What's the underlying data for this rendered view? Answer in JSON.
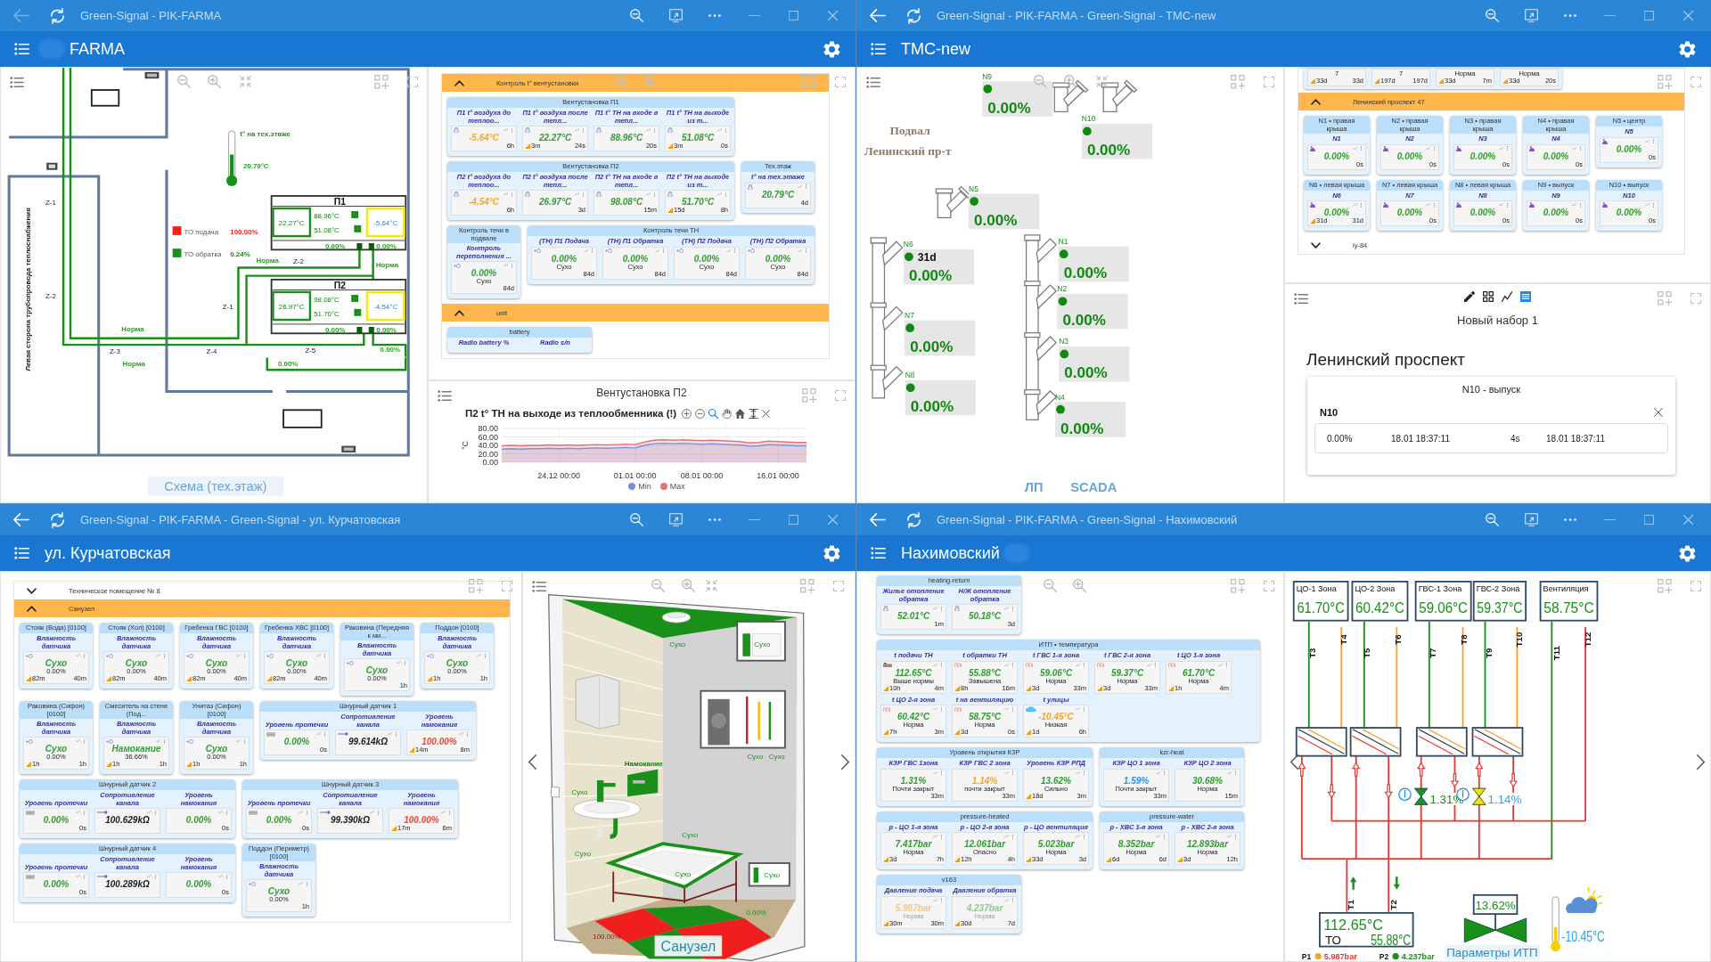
{
  "windows": [
    {
      "title": "Green-Signal - PIK-FARMA",
      "header": "FARMA",
      "back_enabled": false,
      "panes": [
        {
          "kind": "floorplan",
          "outdoor": {
            "label": "t° на тех.этаже",
            "value": "20.79°C"
          },
          "legend": [
            {
              "label": "ТО подача",
              "value": "100.00%",
              "color": "#ff1a1a"
            },
            {
              "label": "ТО обратка",
              "value": "0.24%",
              "color": "#1a8f1a"
            }
          ],
          "units": [
            {
              "name": "П1",
              "air_after": "22.27°C",
              "supply": "88.96°C",
              "return": "51.08°C",
              "air_before": "-5.64°C",
              "valves": [
                "0.00%",
                "0.00%"
              ]
            },
            {
              "name": "П2",
              "air_after": "26.97°C",
              "supply": "98.08°C",
              "return": "51.70°C",
              "air_before": "-4.54°C",
              "valves": [
                "0.00%",
                "0.00%"
              ]
            }
          ],
          "labels": [
            {
              "kind": "status",
              "text": "Норма"
            },
            {
              "kind": "zone",
              "text": "Z-2"
            },
            {
              "kind": "status",
              "text": "Норма"
            },
            {
              "kind": "zone",
              "text": "Z-1"
            },
            {
              "kind": "status",
              "text": "Норма"
            },
            {
              "kind": "zone",
              "text": "Z-3"
            },
            {
              "kind": "zone",
              "text": "Z-4"
            },
            {
              "kind": "zone",
              "text": "Z-5"
            },
            {
              "kind": "reading",
              "text": "0.00%"
            },
            {
              "kind": "status",
              "text": "Норма"
            },
            {
              "kind": "reading",
              "text": "0.00%"
            },
            {
              "kind": "zone",
              "text": "Z-1"
            },
            {
              "kind": "zone",
              "text": "Z-2"
            }
          ],
          "pipe_label": "Левая сторона трубопровода теплоснабжения",
          "caption": "Схема (тех.этаж)"
        },
        {
          "kind": "groups",
          "sections": [
            {
              "title": "Контроль t° вентустановки",
              "expanded": true,
              "groups": [
                {
                  "title": "Вентустановка П1",
                  "tiles": [
                    {
                      "label": "П1 t° воздуха до теплоо...",
                      "kind": "thermo",
                      "value": "-5.64°C",
                      "color": "#f5a623",
                      "updated": "6h"
                    },
                    {
                      "label": "П1 t° воздуха после тепл...",
                      "kind": "thermo",
                      "value": "22.27°C",
                      "color": "#2e9e2e",
                      "age": "3m",
                      "updated": "24s"
                    },
                    {
                      "label": "П1 t° ТН на входе в тепл...",
                      "kind": "thermo",
                      "value": "88.96°C",
                      "color": "#2e9e2e",
                      "updated": "20s"
                    },
                    {
                      "label": "П1 t° ТН на выходе из т...",
                      "kind": "thermo",
                      "value": "51.08°C",
                      "color": "#2e9e2e",
                      "age": "3m",
                      "updated": "0s"
                    }
                  ]
                },
                {
                  "title": "Вентустановка П2",
                  "tiles": [
                    {
                      "label": "П2 t° воздуха до теплоо...",
                      "kind": "thermo",
                      "value": "-4.54°C",
                      "color": "#f5a623",
                      "updated": "6h"
                    },
                    {
                      "label": "П2 t° воздуха после тепл...",
                      "kind": "thermo",
                      "value": "26.97°C",
                      "color": "#2e9e2e",
                      "updated": "3d"
                    },
                    {
                      "label": "П2 t° ТН на входе в тепл...",
                      "kind": "thermo",
                      "value": "98.08°C",
                      "color": "#2e9e2e",
                      "updated": "15m"
                    },
                    {
                      "label": "П2 t° ТН на выходе из т...",
                      "kind": "thermo",
                      "value": "51.70°C",
                      "color": "#2e9e2e",
                      "age": "15d",
                      "updated": "8h"
                    }
                  ]
                },
                {
                  "title": "Тех.этаж",
                  "tiles": [
                    {
                      "label": "t° на тех.этаже",
                      "kind": "thermo",
                      "value": "20.79°C",
                      "color": "#2e9e2e",
                      "updated": "4d"
                    }
                  ]
                },
                {
                  "title": "Контроль течи в подвале",
                  "tiles": [
                    {
                      "label": "Контроль переполнения ...",
                      "kind": "leak",
                      "value": "0.00%",
                      "color": "#2e9e2e",
                      "status": "Сухо",
                      "updated": "84d"
                    }
                  ]
                },
                {
                  "title": "Контроль течи ТН",
                  "tiles": [
                    {
                      "label": "(ТН) П1 Подача",
                      "kind": "leak",
                      "value": "0.00%",
                      "color": "#2e9e2e",
                      "status": "Сухо",
                      "updated": "84d"
                    },
                    {
                      "label": "(ТН) П1 Обратка",
                      "kind": "leak",
                      "value": "0.00%",
                      "color": "#2e9e2e",
                      "status": "Сухо",
                      "updated": "84d"
                    },
                    {
                      "label": "(ТН) П2 Подача",
                      "kind": "leak",
                      "value": "0.00%",
                      "color": "#2e9e2e",
                      "status": "Сухо",
                      "updated": "84d"
                    },
                    {
                      "label": "(ТН) П2 Обратка",
                      "kind": "leak",
                      "value": "0.00%",
                      "color": "#2e9e2e",
                      "status": "Сухо",
                      "updated": "84d"
                    }
                  ]
                }
              ]
            },
            {
              "title": "unit",
              "expanded": true,
              "groups": [
                {
                  "title": "battery",
                  "tiles": [
                    {
                      "label": "Radio battery %"
                    },
                    {
                      "label": "Radio s/n"
                    }
                  ]
                }
              ]
            }
          ]
        },
        {
          "kind": "chart",
          "title": "Вентустановка П2",
          "chart_title": "П2 t° ТН на выходе из теплообменника (!)",
          "chart_data": {
            "type": "area",
            "ylabel": "°C",
            "grid": true,
            "legend": "bottom",
            "categories": [
              null,
              null,
              null,
              null,
              null,
              null,
              "24.12 00:00",
              null,
              null,
              null,
              null,
              null,
              null,
              null,
              "01.01 00:00",
              null,
              null,
              null,
              null,
              null,
              null,
              "08.01 00:00",
              null,
              null,
              null,
              null,
              null,
              null,
              null,
              "16.01 00:00",
              null,
              null,
              null
            ],
            "ylim": [
              0,
              80
            ],
            "yticks": [
              {
                "value": 0,
                "label": "0.00"
              },
              {
                "value": 20,
                "label": "20.00"
              },
              {
                "value": 40,
                "label": "40.00"
              },
              {
                "value": 60,
                "label": "60.00"
              },
              {
                "value": 80,
                "label": "80.00"
              }
            ],
            "series": [
              {
                "name": "Min",
                "color": "#7b8fe0",
                "values": [
                  31,
                  32,
                  31,
                  32,
                  32,
                  33,
                  32,
                  33,
                  32,
                  33,
                  34,
                  33,
                  34,
                  35,
                  34,
                  40,
                  44,
                  45,
                  44,
                  45,
                  44,
                  43,
                  44,
                  43,
                  42,
                  41,
                  38,
                  39,
                  42,
                  41,
                  40,
                  39,
                  39
                ]
              },
              {
                "name": "Max",
                "color": "#e57373",
                "values": [
                  39,
                  40,
                  39,
                  40,
                  40,
                  41,
                  40,
                  41,
                  40,
                  41,
                  42,
                  41,
                  42,
                  43,
                  42,
                  48,
                  52,
                  53,
                  52,
                  53,
                  52,
                  51,
                  52,
                  51,
                  50,
                  49,
                  46,
                  47,
                  50,
                  49,
                  48,
                  47,
                  47
                ]
              }
            ]
          }
        }
      ]
    },
    {
      "title": "Green-Signal - PIK-FARMA - Green-Signal - TMC-new",
      "header": "TMC-new",
      "back_enabled": true,
      "panes": [
        {
          "kind": "nodes",
          "captions": [
            "Подвал",
            "Ленинский пр-т"
          ],
          "nodes": [
            {
              "name": "N9",
              "value": "0.00%"
            },
            {
              "name": "N10",
              "value": "0.00%"
            },
            {
              "name": "N5",
              "value": "0.00%"
            },
            {
              "name": "N6",
              "value": "0.00%",
              "age": "31d"
            },
            {
              "name": "N7",
              "value": "0.00%"
            },
            {
              "name": "N8",
              "value": "0.00%"
            },
            {
              "name": "N1",
              "value": "0.00%"
            },
            {
              "name": "N2",
              "value": "0.00%"
            },
            {
              "name": "N3",
              "value": "0.00%"
            },
            {
              "name": "N4",
              "value": "0.00%"
            }
          ],
          "links": [
            "ЛП",
            "SCADA"
          ]
        },
        {
          "kind": "groups",
          "sections": [
            {
              "groups": [
                {
                  "tiles": [
                    {
                      "status": "7",
                      "age": "33d",
                      "updated": "33d"
                    },
                    {
                      "status": "7",
                      "age": "197d",
                      "updated": "197d"
                    },
                    {
                      "status": "Норма",
                      "age": "33d",
                      "updated": "7m"
                    },
                    {
                      "status": "Норма",
                      "age": "33d",
                      "updated": "20s"
                    }
                  ]
                }
              ]
            },
            {
              "title": "Ленинский проспект 47",
              "expanded": true,
              "groups": [
                {
                  "title": "N1 • правая крыша",
                  "tiles": [
                    {
                      "label": "N1",
                      "kind": "level",
                      "value": "0.00%",
                      "color": "#2e9e2e",
                      "updated": "0s"
                    }
                  ]
                },
                {
                  "title": "N2 • правая крыша",
                  "tiles": [
                    {
                      "label": "N2",
                      "kind": "level",
                      "value": "0.00%",
                      "color": "#2e9e2e",
                      "updated": "0s"
                    }
                  ]
                },
                {
                  "title": "N3 • правая крыша",
                  "tiles": [
                    {
                      "label": "N3",
                      "kind": "level",
                      "value": "0.00%",
                      "color": "#2e9e2e",
                      "updated": "0s"
                    }
                  ]
                },
                {
                  "title": "N4 • правая крыша",
                  "tiles": [
                    {
                      "label": "N4",
                      "kind": "level",
                      "value": "0.00%",
                      "color": "#2e9e2e",
                      "updated": "0s"
                    }
                  ]
                },
                {
                  "title": "N5 • центр",
                  "tiles": [
                    {
                      "label": "N5",
                      "kind": "level",
                      "value": "0.00%",
                      "color": "#2e9e2e",
                      "updated": "0s"
                    }
                  ]
                },
                {
                  "title": "N6 • левая крыша",
                  "tiles": [
                    {
                      "label": "N6",
                      "kind": "level",
                      "value": "0.00%",
                      "color": "#2e9e2e",
                      "age": "31d",
                      "updated": "31d"
                    }
                  ]
                },
                {
                  "title": "N7 • левая крыша",
                  "tiles": [
                    {
                      "label": "N7",
                      "kind": "level",
                      "value": "0.00%",
                      "color": "#2e9e2e",
                      "updated": "0s"
                    }
                  ]
                },
                {
                  "title": "N8 • левая крыша",
                  "tiles": [
                    {
                      "label": "N8",
                      "kind": "level",
                      "value": "0.00%",
                      "color": "#2e9e2e",
                      "updated": "0s"
                    }
                  ]
                },
                {
                  "title": "N9 • выпуск",
                  "tiles": [
                    {
                      "label": "N9",
                      "kind": "level",
                      "value": "0.00%",
                      "color": "#2e9e2e",
                      "updated": "0s"
                    }
                  ]
                },
                {
                  "title": "N10 • выпуск",
                  "tiles": [
                    {
                      "label": "N10",
                      "kind": "level",
                      "value": "0.00%",
                      "color": "#2e9e2e",
                      "updated": "0s"
                    }
                  ]
                }
              ]
            },
            {
              "title": "ly-84",
              "expanded": false
            }
          ]
        },
        {
          "kind": "dataset",
          "tools": [
            {
              "kind": "edit",
              "selected": false
            },
            {
              "kind": "grid",
              "selected": false
            },
            {
              "kind": "trend",
              "selected": false
            },
            {
              "kind": "table",
              "selected": true
            }
          ],
          "title": "Новый набор 1",
          "heading": "Ленинский проспект",
          "card": {
            "title": "N10 - выпуск",
            "name": "N10",
            "cells": [
              "0.00%",
              "18.01 18:37:11",
              "4s",
              "18.01 18:37:11"
            ]
          }
        }
      ]
    },
    {
      "title": "Green-Signal - PIK-FARMA - Green-Signal - ул. Курчатовская",
      "header": "ул. Курчатовская",
      "back_enabled": true,
      "panes": [
        {
          "kind": "groups",
          "sections": [
            {
              "title": "Техническое помещение № 8",
              "expanded": false
            },
            {
              "title": "Санузел",
              "expanded": true,
              "groups": [
                {
                  "title": "Стояк (Вода) [0100]",
                  "tiles": [
                    {
                      "label": "Влажность датчика",
                      "kind": "leak",
                      "value": "Сухо",
                      "color": "#2e9e2e",
                      "status": "0.00%",
                      "age": "82m",
                      "updated": "40m"
                    }
                  ]
                },
                {
                  "title": "Стояк (Хол) [0100]",
                  "tiles": [
                    {
                      "label": "Влажность датчика",
                      "kind": "leak",
                      "value": "Сухо",
                      "color": "#2e9e2e",
                      "status": "0.00%",
                      "age": "82m",
                      "updated": "40m"
                    }
                  ]
                },
                {
                  "title": "Гребенка ГВС [0100]",
                  "tiles": [
                    {
                      "label": "Влажность датчика",
                      "kind": "leak",
                      "value": "Сухо",
                      "color": "#2e9e2e",
                      "status": "0.00%",
                      "age": "82m",
                      "updated": "40m"
                    }
                  ]
                },
                {
                  "title": "Гребенка ХВС [0100]",
                  "tiles": [
                    {
                      "label": "Влажность датчика",
                      "kind": "leak",
                      "value": "Сухо",
                      "color": "#2e9e2e",
                      "status": "0.00%",
                      "age": "82m",
                      "updated": "40m"
                    }
                  ]
                },
                {
                  "title": "Раковина (Передняя к ми...",
                  "tiles": [
                    {
                      "label": "Влажность датчика",
                      "kind": "leak",
                      "value": "Сухо",
                      "color": "#2e9e2e",
                      "status": "0.00%",
                      "updated": "1h"
                    }
                  ]
                },
                {
                  "title": "Поддон [0100]",
                  "tiles": [
                    {
                      "label": "Влажность датчика",
                      "kind": "leak",
                      "value": "Сухо",
                      "color": "#2e9e2e",
                      "status": "0.00%",
                      "age": "1h",
                      "updated": "1h"
                    }
                  ]
                },
                {
                  "title": "Раковина (Сифон) [0100]",
                  "tiles": [
                    {
                      "label": "Влажность датчика",
                      "kind": "leak",
                      "value": "Сухо",
                      "color": "#2e9e2e",
                      "status": "0.00%",
                      "age": "1h",
                      "updated": "1h"
                    }
                  ]
                },
                {
                  "title": "Смеситель на стене (Под...",
                  "tiles": [
                    {
                      "label": "Влажность датчика",
                      "kind": "leak",
                      "value": "Намокание",
                      "color": "#2e9e2e",
                      "status": "36.66%",
                      "age": "1h",
                      "updated": "1h"
                    }
                  ]
                },
                {
                  "title": "Унитаз (Сифон) [0100]",
                  "tiles": [
                    {
                      "label": "Влажность датчика",
                      "kind": "leak",
                      "value": "Сухо",
                      "color": "#2e9e2e",
                      "status": "0.00%",
                      "age": "1h",
                      "updated": "1h"
                    }
                  ]
                },
                {
                  "title": "Шнурный датчик 1",
                  "tiles": [
                    {
                      "label": "Уровень протечки",
                      "kind": "wire",
                      "value": "0.00%",
                      "color": "#2e9e2e",
                      "updated": "0s"
                    },
                    {
                      "label": "Сопротивление канала",
                      "kind": "probe",
                      "value": "99.614kΩ",
                      "color": "#212121"
                    },
                    {
                      "label": "Уровень намокания",
                      "value": "100.00%",
                      "color": "#f44336",
                      "age": "14m",
                      "updated": "8m"
                    }
                  ]
                },
                {
                  "title": "Шнурный датчик 2",
                  "tiles": [
                    {
                      "label": "Уровень протечки",
                      "kind": "wire",
                      "value": "0.00%",
                      "color": "#2e9e2e",
                      "updated": "0s"
                    },
                    {
                      "label": "Сопротивление канала",
                      "kind": "probe",
                      "value": "100.629kΩ",
                      "color": "#212121"
                    },
                    {
                      "label": "Уровень намокания",
                      "value": "0.00%",
                      "color": "#2e9e2e",
                      "updated": "0s"
                    }
                  ]
                },
                {
                  "title": "Шнурный датчик 3",
                  "tiles": [
                    {
                      "label": "Уровень протечки",
                      "kind": "wire",
                      "value": "0.00%",
                      "color": "#2e9e2e",
                      "updated": "0s"
                    },
                    {
                      "label": "Сопротивление канала",
                      "kind": "probe",
                      "value": "99.390kΩ",
                      "color": "#212121"
                    },
                    {
                      "label": "Уровень намокания",
                      "value": "100.00%",
                      "color": "#f44336",
                      "age": "17m",
                      "updated": "6m"
                    }
                  ]
                },
                {
                  "title": "Шнурный датчик 4",
                  "tiles": [
                    {
                      "label": "Уровень протечки",
                      "kind": "wire",
                      "value": "0.00%",
                      "color": "#2e9e2e",
                      "updated": "0s"
                    },
                    {
                      "label": "Сопротивление канала",
                      "kind": "probe",
                      "value": "100.289kΩ",
                      "color": "#212121"
                    },
                    {
                      "label": "Уровень намокания",
                      "value": "0.00%",
                      "color": "#2e9e2e",
                      "updated": "0s"
                    }
                  ]
                },
                {
                  "title": "Поддон (Периметр) [0100]",
                  "tiles": [
                    {
                      "label": "Влажность датчика",
                      "kind": "leak",
                      "value": "Сухо",
                      "color": "#2e9e2e",
                      "status": "0.00%",
                      "updated": "1h"
                    }
                  ]
                }
              ]
            }
          ]
        },
        {
          "kind": "bathroom",
          "floor": [
            {
              "alarm": true
            },
            {
              "alarm": false
            },
            {
              "alarm": true
            },
            {
              "alarm": false
            }
          ],
          "labels": [
            {
              "kind": "dry",
              "text": "Сухо"
            },
            {
              "kind": "dry",
              "text": "Сухо"
            },
            {
              "kind": "dry",
              "text": "Сухо"
            },
            {
              "kind": "dry",
              "text": "Сухо"
            },
            {
              "kind": "wet",
              "text": "Намокание"
            },
            {
              "kind": "dry",
              "text": "Сухо"
            },
            {
              "kind": "dry",
              "text": "Сухо"
            },
            {
              "kind": "dry",
              "text": "Сухо"
            },
            {
              "kind": "dry",
              "text": "Сухо"
            },
            {
              "kind": "dry",
              "text": "Сухо"
            },
            {
              "kind": "alarm",
              "text": "100.00%"
            },
            {
              "kind": "reading",
              "text": "0.00%"
            }
          ],
          "caption": "Санузел"
        }
      ]
    },
    {
      "title": "Green-Signal - PIK-FARMA - Green-Signal - Нахимовский",
      "header": "Нахимовский",
      "back_enabled": true,
      "panes": [
        {
          "kind": "groups",
          "sections": [
            {
              "groups": [
                {
                  "title": "heating-return",
                  "tiles": [
                    {
                      "label": "Жилье отопление обратка",
                      "kind": "thermo",
                      "value": "52.01°C",
                      "color": "#2e9e2e",
                      "updated": "1m"
                    },
                    {
                      "label": "Н/Ж отопление обратка",
                      "kind": "thermo",
                      "value": "50.18°C",
                      "color": "#2e9e2e",
                      "updated": "3d"
                    }
                  ]
                },
                {
                  "title": "ИТП • температура",
                  "tiles": [
                    {
                      "label": "t подачи ТН",
                      "kind": "pipe",
                      "value": "112.65°C",
                      "color": "#2e9e2e",
                      "status": "Выше нормы",
                      "age": "10h",
                      "updated": "4m"
                    },
                    {
                      "label": "t обратки ТН",
                      "kind": "radiator",
                      "value": "55.88°C",
                      "color": "#2e9e2e",
                      "status": "Завышена",
                      "age": "8h",
                      "updated": "16m"
                    },
                    {
                      "label": "t ГВС 1-я зона",
                      "kind": "radiator",
                      "value": "59.06°C",
                      "color": "#2e9e2e",
                      "status": "Норма",
                      "age": "3d",
                      "updated": "33m"
                    },
                    {
                      "label": "t ГВС 2-я зона",
                      "kind": "radiator",
                      "value": "59.37°C",
                      "color": "#2e9e2e",
                      "status": "Норма",
                      "age": "3d",
                      "updated": "33m"
                    },
                    {
                      "label": "t ЦО 1-я зона",
                      "kind": "radiator",
                      "value": "61.70°C",
                      "color": "#2e9e2e",
                      "status": "Норма",
                      "age": "1h",
                      "updated": "4m"
                    },
                    {
                      "label": "t ЦО 2-я зона",
                      "kind": "radiator",
                      "value": "60.42°C",
                      "color": "#2e9e2e",
                      "status": "Норма",
                      "age": "7h",
                      "updated": "3m"
                    },
                    {
                      "label": "t на вентиляцию",
                      "kind": "radiator",
                      "value": "58.75°C",
                      "color": "#2e9e2e",
                      "status": "Норма",
                      "age": "3d",
                      "updated": "0s"
                    },
                    {
                      "label": "t улицы",
                      "kind": "weather",
                      "value": "-10.45°C",
                      "color": "#f5a623",
                      "status": "Низкая",
                      "age": "1d",
                      "updated": "6h"
                    }
                  ]
                },
                {
                  "title": "Уровень открытия КЗР",
                  "tiles": [
                    {
                      "label": "КЗР ГВС 1зона",
                      "value": "1.31%",
                      "color": "#2e9e2e",
                      "status": "Почти закрыт",
                      "updated": "33m"
                    },
                    {
                      "label": "КЗР ГВС 2 зона",
                      "value": "1.14%",
                      "color": "#f5a623",
                      "status": "почти закрыт",
                      "updated": "33m"
                    },
                    {
                      "label": "Уровень КЗР РПД",
                      "value": "13.62%",
                      "color": "#2e9e2e",
                      "status": "Сильно",
                      "age": "18d",
                      "updated": "3m"
                    }
                  ]
                },
                {
                  "title": "kzr-heat",
                  "tiles": [
                    {
                      "label": "КЗР ЦО 1 зона",
                      "value": "1.59%",
                      "color": "#2196f3",
                      "status": "Почти закрыт",
                      "updated": "33m"
                    },
                    {
                      "label": "КЗР ЦО 2 зона",
                      "value": "30.68%",
                      "color": "#2e9e2e",
                      "status": "Норма",
                      "updated": "15m"
                    }
                  ]
                },
                {
                  "title": "pressure-heated",
                  "tiles": [
                    {
                      "label": "p - ЦО 1-я зона",
                      "value": "7.417bar",
                      "color": "#2e9e2e",
                      "status": "Норма",
                      "age": "3d",
                      "updated": "7h"
                    },
                    {
                      "label": "p - ЦО 2-я зона",
                      "value": "12.061bar",
                      "color": "#2e9e2e",
                      "status": "Опасно",
                      "age": "12h",
                      "updated": "4h"
                    },
                    {
                      "label": "p - ЦО вентиляция",
                      "value": "5.023bar",
                      "color": "#2e9e2e",
                      "status": "Норма",
                      "age": "33d",
                      "updated": "3d"
                    }
                  ]
                },
                {
                  "title": "pressure-water",
                  "tiles": [
                    {
                      "label": "p - ХВС 1-я зона",
                      "value": "8.352bar",
                      "color": "#2e9e2e",
                      "status": "Норма",
                      "age": "6d",
                      "updated": "6d"
                    },
                    {
                      "label": "p - ХВС 2-я зона",
                      "value": "12.893bar",
                      "color": "#2e9e2e",
                      "status": "Норма",
                      "age": "3d",
                      "updated": "12h"
                    }
                  ]
                },
                {
                  "title": "v163",
                  "tiles": [
                    {
                      "label": "Давление подача",
                      "value": "5.987bar",
                      "color": "#f8c48a",
                      "status": "Норма",
                      "age": "30m",
                      "updated": "30m",
                      "stale": true
                    },
                    {
                      "label": "Давление обратка",
                      "value": "4.237bar",
                      "color": "#8fc98f",
                      "status": "Норма",
                      "age": "30d",
                      "updated": "7d",
                      "stale": true
                    }
                  ]
                }
              ]
            }
          ]
        },
        {
          "kind": "itp",
          "zones": [
            {
              "name": "ЦО-1 Зона",
              "value": "61.70°C"
            },
            {
              "name": "ЦО-2 Зона",
              "value": "60.42°C"
            },
            {
              "name": "ГВС-1 Зона",
              "value": "59.06°C"
            },
            {
              "name": "ГВС-2 Зона",
              "value": "59.37°C"
            },
            {
              "name": "Вентиляция",
              "value": "58.75°C"
            }
          ],
          "pipes": [
            "T3",
            "T4",
            "T5",
            "T6",
            "T7",
            "T8",
            "T9",
            "T10",
            "T11",
            "T12"
          ],
          "inlets": [
            "T1",
            "T2"
          ],
          "exchanger": {
            "supply": "112.65°C",
            "name": "ТО",
            "return": "55.88°C"
          },
          "valves": [
            {
              "value": "1.31%",
              "color": "#1a8f3c"
            },
            {
              "value": "1.14%",
              "color": "#f5e400"
            }
          ],
          "pump": "13.62%",
          "outdoor": "-10.45°C",
          "caption": "Параметры ИТП",
          "pressures": [
            {
              "name": "P1",
              "value": "5.987bar",
              "color": "#f5a623"
            },
            {
              "name": "P2",
              "value": "4.237bar",
              "color": "#1a8f1a"
            }
          ]
        }
      ]
    }
  ]
}
